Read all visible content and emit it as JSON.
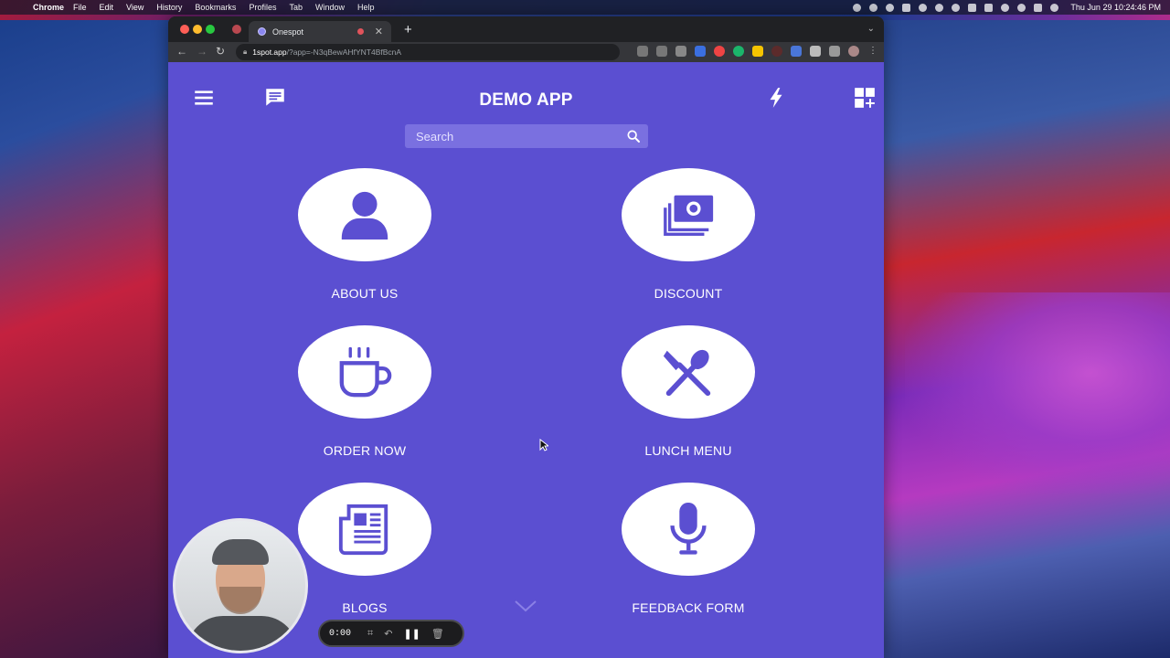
{
  "menubar": {
    "app_name": "Chrome",
    "menus": [
      "File",
      "Edit",
      "View",
      "History",
      "Bookmarks",
      "Profiles",
      "Tab",
      "Window",
      "Help"
    ],
    "clock": "Thu Jun 29  10:24:46 PM"
  },
  "browser": {
    "tab_title": "Onespot",
    "url_host": "1spot.app",
    "url_rest": "/?app=-N3qBewAHfYNT4BfBcnA"
  },
  "app": {
    "title": "DEMO APP",
    "search_placeholder": "Search",
    "tiles": [
      {
        "label": "ABOUT US",
        "icon": "user-icon"
      },
      {
        "label": "DISCOUNT",
        "icon": "money-icon"
      },
      {
        "label": "ORDER NOW",
        "icon": "coffee-cup-icon"
      },
      {
        "label": "LUNCH MENU",
        "icon": "utensils-icon"
      },
      {
        "label": "BLOGS",
        "icon": "newspaper-icon"
      },
      {
        "label": "FEEDBACK FORM",
        "icon": "microphone-icon"
      }
    ],
    "colors": {
      "background": "#5b4fd1",
      "tile": "#ffffff",
      "icon": "#5b4fd1"
    }
  },
  "recorder": {
    "timer": "0:00"
  }
}
